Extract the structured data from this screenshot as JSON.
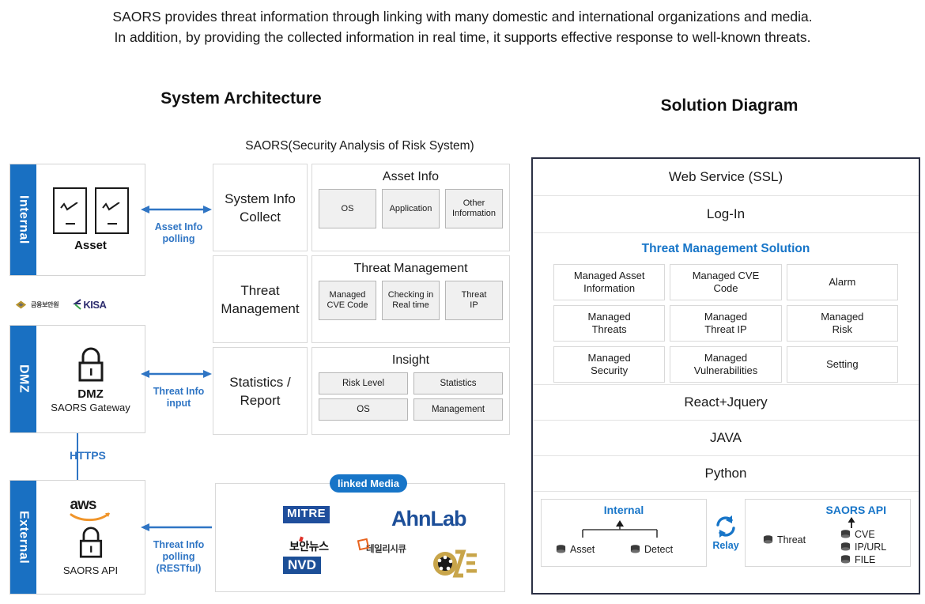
{
  "intro": {
    "line1": "SAORS provides threat information through linking with many domestic and international organizations and media.",
    "line2": "In addition, by providing the collected information in real time, it supports effective response to well-known threats."
  },
  "architecture": {
    "title": "System Architecture",
    "saors_caption": "SAORS(Security Analysis of Risk System)",
    "zones": [
      {
        "tab": "Internal",
        "label": "Asset",
        "sub": ""
      },
      {
        "tab": "DMZ",
        "label": "DMZ",
        "sub": "SAORS Gateway"
      },
      {
        "tab": "External",
        "label": "",
        "sub": "SAORS API"
      }
    ],
    "partner_logos": [
      {
        "name": "금융보안원"
      },
      {
        "name": "KISA"
      }
    ],
    "aws_logo": "aws",
    "connectors": [
      {
        "label1": "Asset Info",
        "label2": "polling",
        "label3": "",
        "type": "double"
      },
      {
        "label1": "Threat Info",
        "label2": "input",
        "label3": "",
        "type": "double"
      },
      {
        "label1": "Threat Info",
        "label2": "polling",
        "label3": "(RESTful)",
        "type": "single-left"
      }
    ],
    "https_label": "HTTPS",
    "modules": [
      {
        "left": "System Info\nCollect",
        "left_l1": "System Info",
        "left_l2": "Collect",
        "title": "Asset Info",
        "chips": [
          "OS",
          "Application",
          "Other\nInformation"
        ],
        "chips_l": [
          {
            "l1": "OS",
            "l2": ""
          },
          {
            "l1": "Application",
            "l2": ""
          },
          {
            "l1": "Other",
            "l2": "Information"
          }
        ]
      },
      {
        "left_l1": "Threat",
        "left_l2": "Management",
        "title": "Threat Management",
        "chips_l": [
          {
            "l1": "Managed",
            "l2": "CVE Code"
          },
          {
            "l1": "Checking in",
            "l2": "Real time"
          },
          {
            "l1": "Threat",
            "l2": "IP"
          }
        ]
      },
      {
        "left_l1": "Statistics /",
        "left_l2": "Report",
        "title": "Insight",
        "chips_wide": [
          [
            "Risk Level",
            "Statistics"
          ],
          [
            "OS",
            "Management"
          ]
        ]
      }
    ],
    "media": {
      "badge": "linked Media",
      "logos": [
        "MITRE",
        "AhnLab",
        "보안뉴스",
        "데일리시큐",
        "NVD",
        "CVE"
      ]
    }
  },
  "solution": {
    "title": "Solution Diagram",
    "rows_top": [
      "Web Service (SSL)",
      "Log-In"
    ],
    "tms_title": "Threat Management Solution",
    "tms_cells": [
      {
        "l1": "Managed Asset",
        "l2": "Information"
      },
      {
        "l1": "Managed CVE",
        "l2": "Code"
      },
      {
        "l1": "Alarm",
        "l2": ""
      },
      {
        "l1": "Managed",
        "l2": "Threats"
      },
      {
        "l1": "Managed",
        "l2": "Threat IP"
      },
      {
        "l1": "Managed",
        "l2": "Risk"
      },
      {
        "l1": "Managed",
        "l2": "Security"
      },
      {
        "l1": "Managed",
        "l2": "Vulnerabilities"
      },
      {
        "l1": "Setting",
        "l2": ""
      }
    ],
    "stack_rows": [
      "React+Jquery",
      "JAVA",
      "Python"
    ],
    "bottom": {
      "internal_title": "Internal",
      "internal_dbs": [
        "Asset",
        "Detect"
      ],
      "relay_label": "Relay",
      "saors_title": "SAORS API",
      "saors_threat": "Threat",
      "saors_dbs": [
        "CVE",
        "IP/URL",
        "FILE"
      ]
    }
  },
  "colors": {
    "accent_blue": "#1775c8",
    "zone_blue": "#1970c2",
    "frame_navy": "#2b3044",
    "chip_gray": "#f0f0f0"
  }
}
